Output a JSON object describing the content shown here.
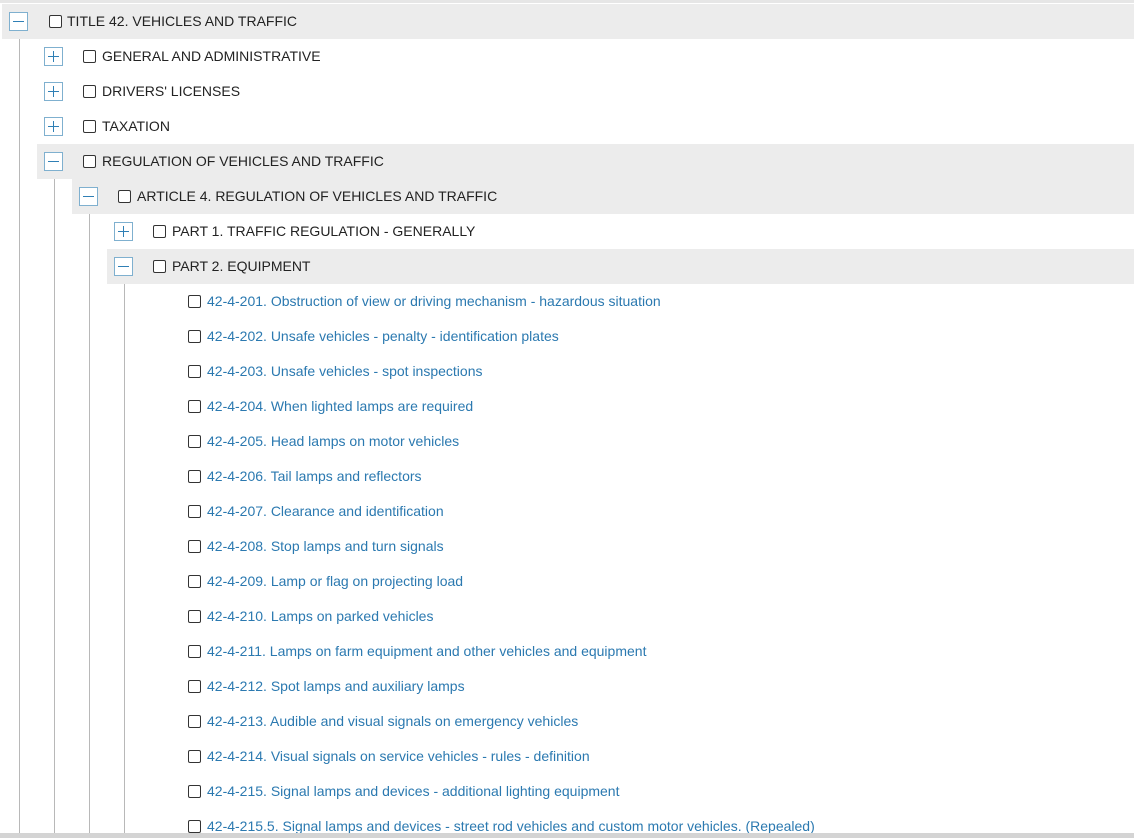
{
  "tree": {
    "title_node": {
      "label": "TITLE 42. VEHICLES AND TRAFFIC",
      "state": "expanded",
      "toggle_icon": "minus-icon"
    },
    "sections": [
      {
        "label": "GENERAL AND ADMINISTRATIVE",
        "state": "collapsed",
        "toggle_icon": "plus-icon"
      },
      {
        "label": "DRIVERS' LICENSES",
        "state": "collapsed",
        "toggle_icon": "plus-icon"
      },
      {
        "label": "TAXATION",
        "state": "collapsed",
        "toggle_icon": "plus-icon"
      },
      {
        "label": "REGULATION OF VEHICLES AND TRAFFIC",
        "state": "expanded",
        "toggle_icon": "minus-icon"
      }
    ],
    "article": {
      "label": "ARTICLE 4. REGULATION OF VEHICLES AND TRAFFIC",
      "state": "expanded",
      "toggle_icon": "minus-icon"
    },
    "parts": [
      {
        "label": "PART 1. TRAFFIC REGULATION - GENERALLY",
        "state": "collapsed",
        "toggle_icon": "plus-icon"
      },
      {
        "label": "PART 2. EQUIPMENT",
        "state": "expanded",
        "toggle_icon": "minus-icon"
      }
    ],
    "statutes": [
      {
        "label": "42-4-201. Obstruction of view or driving mechanism - hazardous situation"
      },
      {
        "label": "42-4-202. Unsafe vehicles - penalty - identification plates"
      },
      {
        "label": "42-4-203. Unsafe vehicles - spot inspections"
      },
      {
        "label": "42-4-204. When lighted lamps are required"
      },
      {
        "label": "42-4-205. Head lamps on motor vehicles"
      },
      {
        "label": "42-4-206. Tail lamps and reflectors"
      },
      {
        "label": "42-4-207. Clearance and identification"
      },
      {
        "label": "42-4-208. Stop lamps and turn signals"
      },
      {
        "label": "42-4-209. Lamp or flag on projecting load"
      },
      {
        "label": "42-4-210. Lamps on parked vehicles"
      },
      {
        "label": "42-4-211. Lamps on farm equipment and other vehicles and equipment"
      },
      {
        "label": "42-4-212. Spot lamps and auxiliary lamps"
      },
      {
        "label": "42-4-213. Audible and visual signals on emergency vehicles"
      },
      {
        "label": "42-4-214. Visual signals on service vehicles - rules - definition"
      },
      {
        "label": "42-4-215. Signal lamps and devices - additional lighting equipment"
      },
      {
        "label": "42-4-215.5. Signal lamps and devices - street rod vehicles and custom motor vehicles. (Repealed)"
      }
    ],
    "colors": {
      "node_text": "#222222",
      "link_text": "#2b79b0",
      "expanded_row_bg": "#ececec",
      "toggle_border": "#7fb0cf",
      "toggle_glyph": "#2f7fb5",
      "tree_line": "#b8b8b8"
    }
  }
}
